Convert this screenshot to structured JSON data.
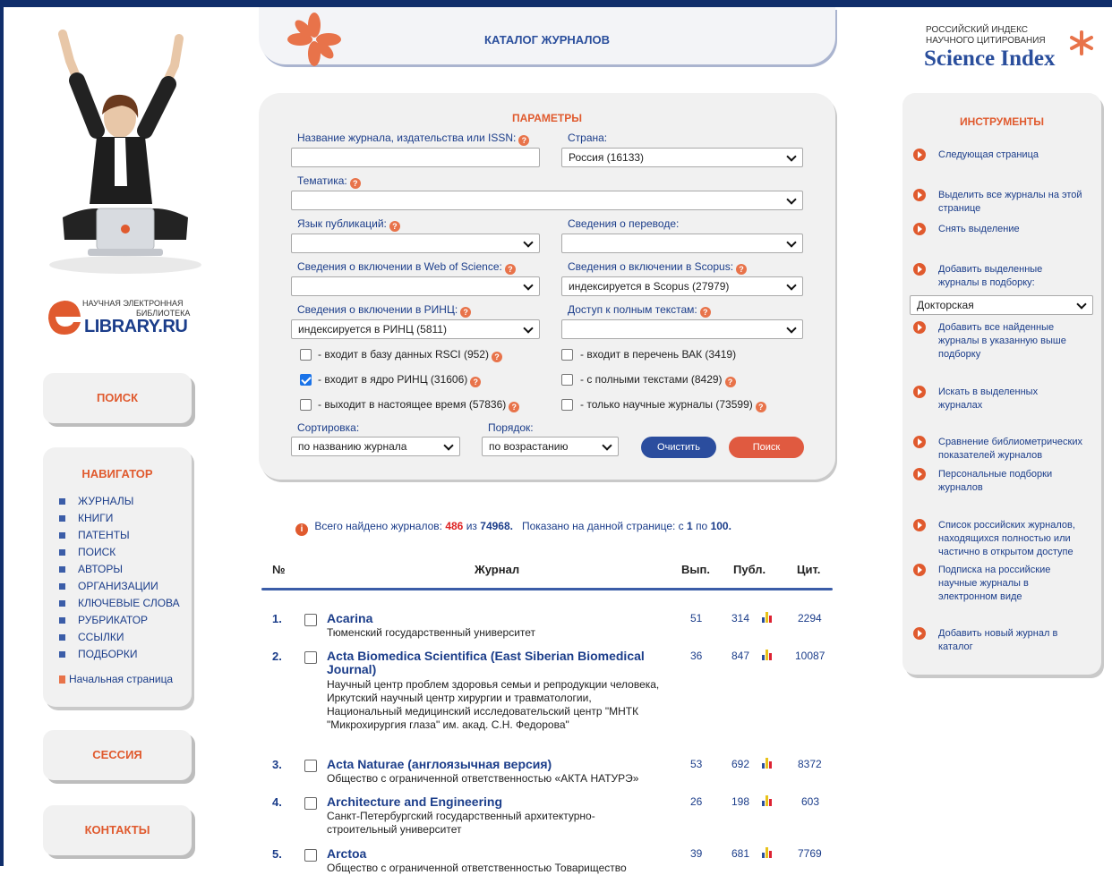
{
  "header": {
    "catalog_title": "КАТАЛОГ ЖУРНАЛОВ",
    "logo_line1": "РОССИЙСКИЙ ИНДЕКС",
    "logo_line2": "НАУЧНОГО ЦИТИРОВАНИЯ",
    "logo_main": "Science Index"
  },
  "elibrary": {
    "line1": "НАУЧНАЯ ЭЛЕКТРОННАЯ",
    "line2": "БИБЛИОТЕКА",
    "brand": "LIBRARY.RU"
  },
  "left": {
    "search_label": "ПОИСК",
    "navigator_title": "НАВИГАТОР",
    "nav_items": [
      "ЖУРНАЛЫ",
      "КНИГИ",
      "ПАТЕНТЫ",
      "ПОИСК",
      "АВТОРЫ",
      "ОРГАНИЗАЦИИ",
      "КЛЮЧЕВЫЕ СЛОВА",
      "РУБРИКАТОР",
      "ССЫЛКИ",
      "ПОДБОРКИ"
    ],
    "home_link": "Начальная страница",
    "session_label": "СЕССИЯ",
    "contacts_label": "КОНТАКТЫ"
  },
  "params": {
    "title": "ПАРАМЕТРЫ",
    "name_label": "Название журнала, издательства или ISSN:",
    "name_value": "",
    "country_label": "Страна:",
    "country_value": "Россия  (16133)",
    "topic_label": "Тематика:",
    "topic_value": "",
    "lang_label": "Язык публикаций:",
    "lang_value": "",
    "translation_label": "Сведения о переводе:",
    "translation_value": "",
    "wos_label": "Сведения о включении в Web of Science:",
    "wos_value": "",
    "scopus_label": "Сведения о включении в Scopus:",
    "scopus_value": "индексируется в Scopus  (27979)",
    "rinc_label": "Сведения о включении в РИНЦ:",
    "rinc_value": "индексируется в РИНЦ  (5811)",
    "access_label": "Доступ к полным текстам:",
    "access_value": "",
    "checks": {
      "rsci": {
        "label": "- входит в базу данных RSCI (952)",
        "checked": false
      },
      "vak": {
        "label": "- входит в перечень ВАК (3419)",
        "checked": false
      },
      "core": {
        "label": "- входит в ядро РИНЦ (31606)",
        "checked": true
      },
      "fulltext": {
        "label": "- с полными текстами (8429)",
        "checked": false
      },
      "current": {
        "label": "- выходит в настоящее время (57836)",
        "checked": false
      },
      "scientific": {
        "label": "- только научные журналы (73599)",
        "checked": false
      }
    },
    "sort_label": "Сортировка:",
    "sort_value": "по названию журнала",
    "order_label": "Порядок:",
    "order_value": "по возрастанию",
    "clear_button": "Очистить",
    "search_button": "Поиск"
  },
  "summary": {
    "prefix": "Всего найдено журналов:",
    "found": "486",
    "of": "из",
    "total": "74968.",
    "shown": "Показано на данной странице: с",
    "from": "1",
    "to_word": "по",
    "to": "100."
  },
  "table": {
    "headers": {
      "num": "№",
      "journal": "Журнал",
      "issues": "Вып.",
      "pubs": "Публ.",
      "cites": "Цит."
    },
    "rows": [
      {
        "num": "1.",
        "title": "Acarina",
        "publisher": "Тюменский государственный университет",
        "issues": "51",
        "pubs": "314",
        "cites": "2294"
      },
      {
        "num": "2.",
        "title": "Acta Biomedica Scientifica (East Siberian Biomedical Journal)",
        "publisher": "Научный центр проблем здоровья семьи и репродукции человека, Иркутский научный центр хирургии и травматологии, Национальный медицинский исследовательский центр \"МНТК \"Микрохирургия глаза\" им. акад. С.Н. Федорова\"",
        "issues": "36",
        "pubs": "847",
        "cites": "10087"
      },
      {
        "num": "3.",
        "title": "Acta Naturae (англоязычная версия)",
        "publisher": "Общество с ограниченной ответственностью «АКТА НАТУРЭ»",
        "issues": "53",
        "pubs": "692",
        "cites": "8372"
      },
      {
        "num": "4.",
        "title": "Architecture and Engineering",
        "publisher": "Санкт-Петербургский государственный архитектурно-строительный университет",
        "issues": "26",
        "pubs": "198",
        "cites": "603"
      },
      {
        "num": "5.",
        "title": "Arctoa",
        "publisher": "Общество с ограниченной ответственностью Товарищество",
        "issues": "39",
        "pubs": "681",
        "cites": "7769"
      }
    ]
  },
  "tools": {
    "title": "ИНСТРУМЕНТЫ",
    "next_page": "Следующая страница",
    "select_all": "Выделить все журналы на этой странице",
    "deselect": "Снять выделение",
    "add_selected": "Добавить выделенные журналы в подборку:",
    "collection_value": "Докторская",
    "add_all": "Добавить все найденные журналы в указанную выше подборку",
    "search_in": "Искать в выделенных журналах",
    "compare": "Сравнение библиометрических показателей журналов",
    "personal": "Персональные подборки журналов",
    "open_access": "Список российских журналов, находящихся полностью или частично в открытом доступе",
    "subscribe": "Подписка на российские научные журналы в электронном виде",
    "add_new": "Добавить новый журнал в каталог"
  },
  "colors": {
    "accent": "#e05a2e",
    "navy": "#1b3d8a",
    "panel": "#f1f1f1"
  }
}
